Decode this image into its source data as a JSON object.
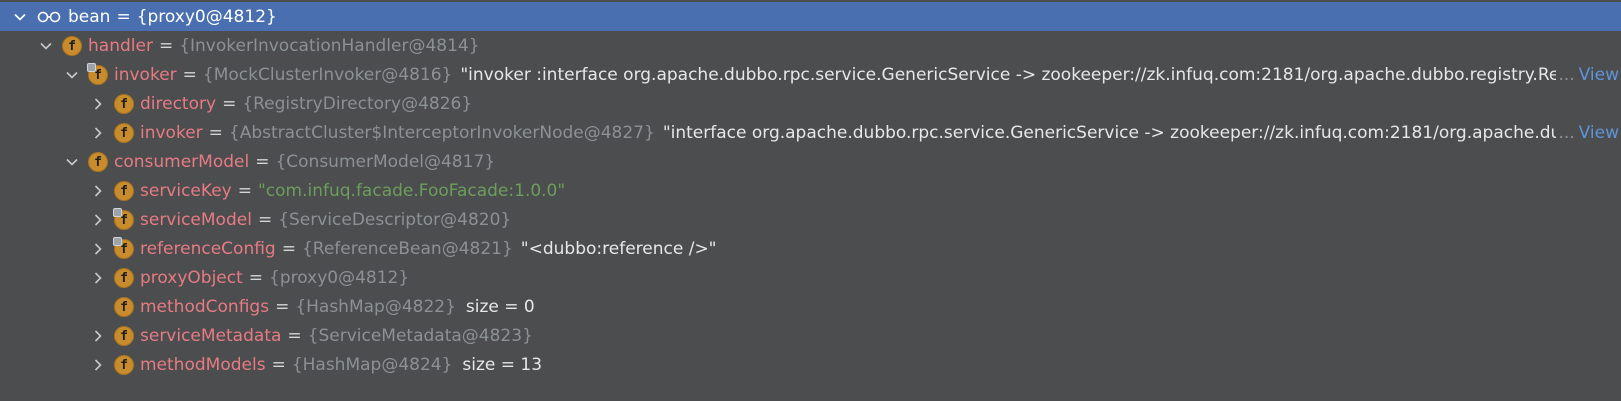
{
  "colors": {
    "background": "#4b4d4e",
    "selection": "#4a6fb1",
    "field_name": "#e77b84",
    "reference": "#8b9195",
    "string_value": "#6d9e5b",
    "link": "#5f94d8",
    "field_icon": "#c98c2d"
  },
  "tree": {
    "root": {
      "icon": "watch-glasses-icon",
      "name": "bean",
      "equals": "=",
      "ref": "{proxy0@4812}"
    },
    "rows": [
      {
        "id": "handler",
        "name": "handler",
        "equals": "=",
        "ref": "{InvokerInvocationHandler@4814}",
        "tostring": "",
        "size": "",
        "expanded": true,
        "icon": "field-icon",
        "locked": false
      },
      {
        "id": "invoker",
        "name": "invoker",
        "equals": "=",
        "ref": "{MockClusterInvoker@4816}",
        "tostring": "\"invoker :interface org.apache.dubbo.rpc.service.GenericService -> zookeeper://zk.infuq.com:2181/org.apache.dubbo.registry.Re",
        "ellipsis": "...",
        "view": "View",
        "expanded": true,
        "icon": "field-icon",
        "locked": true
      },
      {
        "id": "directory",
        "name": "directory",
        "equals": "=",
        "ref": "{RegistryDirectory@4826}",
        "tostring": "",
        "expanded": false,
        "icon": "field-icon",
        "locked": false
      },
      {
        "id": "invoker2",
        "name": "invoker",
        "equals": "=",
        "ref": "{AbstractCluster$InterceptorInvokerNode@4827}",
        "tostring": "\"interface org.apache.dubbo.rpc.service.GenericService -> zookeeper://zk.infuq.com:2181/org.apache.du",
        "ellipsis": "...",
        "view": "View",
        "expanded": false,
        "icon": "field-icon",
        "locked": false
      },
      {
        "id": "consumerModel",
        "name": "consumerModel",
        "equals": "=",
        "ref": "{ConsumerModel@4817}",
        "tostring": "",
        "expanded": true,
        "icon": "field-icon",
        "locked": false
      },
      {
        "id": "serviceKey",
        "name": "serviceKey",
        "equals": "=",
        "str": "\"com.infuq.facade.FooFacade:1.0.0\"",
        "expanded": false,
        "icon": "field-icon",
        "locked": false
      },
      {
        "id": "serviceModel",
        "name": "serviceModel",
        "equals": "=",
        "ref": "{ServiceDescriptor@4820}",
        "expanded": false,
        "icon": "field-icon",
        "locked": true
      },
      {
        "id": "referenceConfig",
        "name": "referenceConfig",
        "equals": "=",
        "ref": "{ReferenceBean@4821}",
        "tostring": "\"<dubbo:reference />\"",
        "expanded": false,
        "icon": "field-icon",
        "locked": true
      },
      {
        "id": "proxyObject",
        "name": "proxyObject",
        "equals": "=",
        "ref": "{proxy0@4812}",
        "expanded": false,
        "icon": "field-icon",
        "locked": false
      },
      {
        "id": "methodConfigs",
        "name": "methodConfigs",
        "equals": "=",
        "ref": "{HashMap@4822}",
        "size": "size = 0",
        "expanded": null,
        "icon": "field-icon",
        "locked": false
      },
      {
        "id": "serviceMetadata",
        "name": "serviceMetadata",
        "equals": "=",
        "ref": "{ServiceMetadata@4823}",
        "expanded": false,
        "icon": "field-icon",
        "locked": false
      },
      {
        "id": "methodModels",
        "name": "methodModels",
        "equals": "=",
        "ref": "{HashMap@4824}",
        "size": "size = 13",
        "expanded": false,
        "icon": "field-icon",
        "locked": false
      }
    ],
    "field_icon_letter": "f"
  }
}
